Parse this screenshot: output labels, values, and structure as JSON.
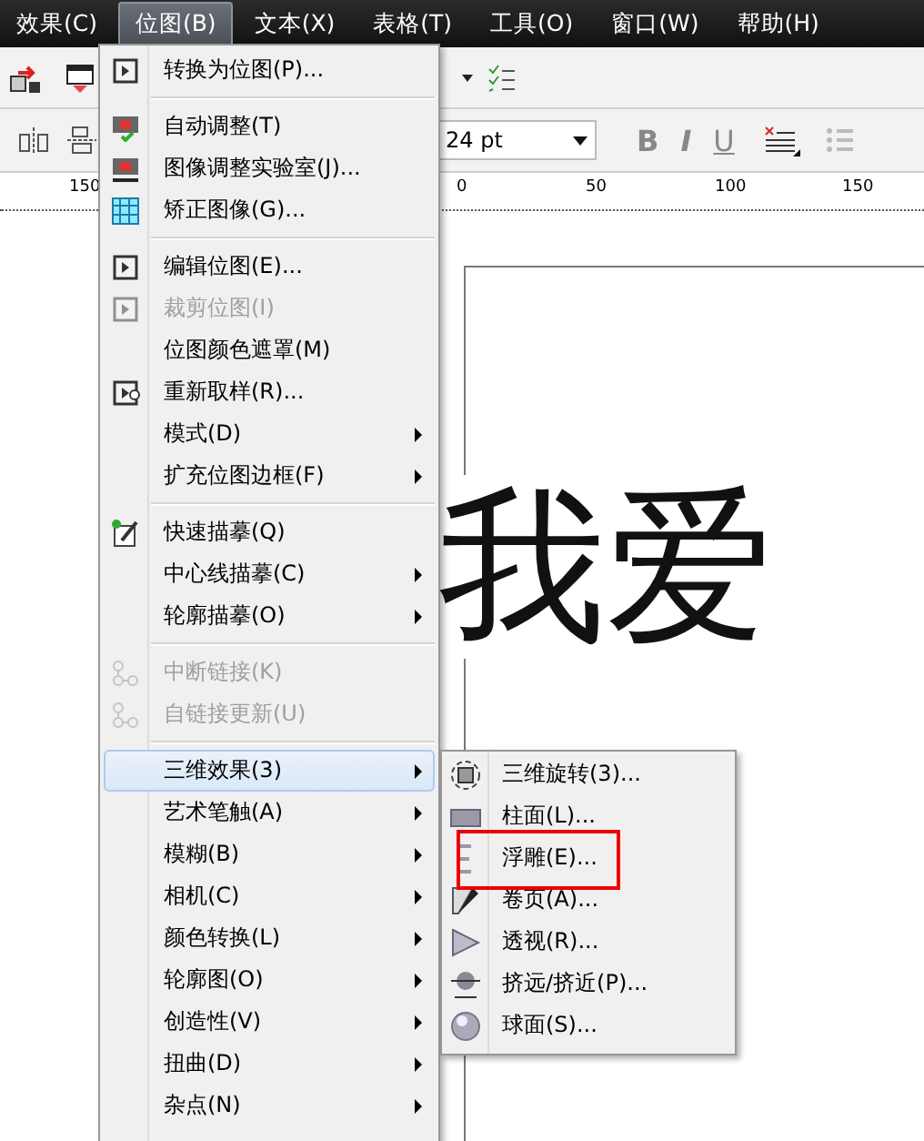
{
  "menubar": [
    {
      "label": "效果(C)",
      "selected": false
    },
    {
      "label": "位图(B)",
      "selected": true
    },
    {
      "label": "文本(X)",
      "selected": false
    },
    {
      "label": "表格(T)",
      "selected": false
    },
    {
      "label": "工具(O)",
      "selected": false
    },
    {
      "label": "窗口(W)",
      "selected": false
    },
    {
      "label": "帮助(H)",
      "selected": false
    }
  ],
  "toolbar": {
    "font_size": "24 pt",
    "format_buttons": [
      "B",
      "I",
      "U"
    ]
  },
  "ruler": {
    "labels": [
      "150",
      "0",
      "50",
      "100",
      "150"
    ]
  },
  "canvas": {
    "text": "我爱"
  },
  "menu": [
    {
      "kind": "item",
      "label": "转换为位图(P)...",
      "disabled": false,
      "submenu": false,
      "selected": false
    },
    {
      "kind": "separator"
    },
    {
      "kind": "item",
      "label": "自动调整(T)",
      "disabled": false,
      "submenu": false,
      "selected": false
    },
    {
      "kind": "item",
      "label": "图像调整实验室(J)...",
      "disabled": false,
      "submenu": false,
      "selected": false
    },
    {
      "kind": "item",
      "label": "矫正图像(G)...",
      "disabled": false,
      "submenu": false,
      "selected": false
    },
    {
      "kind": "separator"
    },
    {
      "kind": "item",
      "label": "编辑位图(E)...",
      "disabled": false,
      "submenu": false,
      "selected": false
    },
    {
      "kind": "item",
      "label": "裁剪位图(I)",
      "disabled": true,
      "submenu": false,
      "selected": false
    },
    {
      "kind": "item",
      "label": "位图颜色遮罩(M)",
      "disabled": false,
      "submenu": false,
      "selected": false
    },
    {
      "kind": "item",
      "label": "重新取样(R)...",
      "disabled": false,
      "submenu": false,
      "selected": false
    },
    {
      "kind": "item",
      "label": "模式(D)",
      "disabled": false,
      "submenu": true,
      "selected": false
    },
    {
      "kind": "item",
      "label": "扩充位图边框(F)",
      "disabled": false,
      "submenu": true,
      "selected": false
    },
    {
      "kind": "separator"
    },
    {
      "kind": "item",
      "label": "快速描摹(Q)",
      "disabled": false,
      "submenu": false,
      "selected": false
    },
    {
      "kind": "item",
      "label": "中心线描摹(C)",
      "disabled": false,
      "submenu": true,
      "selected": false
    },
    {
      "kind": "item",
      "label": "轮廓描摹(O)",
      "disabled": false,
      "submenu": true,
      "selected": false
    },
    {
      "kind": "separator"
    },
    {
      "kind": "item",
      "label": "中断链接(K)",
      "disabled": true,
      "submenu": false,
      "selected": false
    },
    {
      "kind": "item",
      "label": "自链接更新(U)",
      "disabled": true,
      "submenu": false,
      "selected": false
    },
    {
      "kind": "separator"
    },
    {
      "kind": "item",
      "label": "三维效果(3)",
      "disabled": false,
      "submenu": true,
      "selected": true
    },
    {
      "kind": "item",
      "label": "艺术笔触(A)",
      "disabled": false,
      "submenu": true,
      "selected": false
    },
    {
      "kind": "item",
      "label": "模糊(B)",
      "disabled": false,
      "submenu": true,
      "selected": false
    },
    {
      "kind": "item",
      "label": "相机(C)",
      "disabled": false,
      "submenu": true,
      "selected": false
    },
    {
      "kind": "item",
      "label": "颜色转换(L)",
      "disabled": false,
      "submenu": true,
      "selected": false
    },
    {
      "kind": "item",
      "label": "轮廓图(O)",
      "disabled": false,
      "submenu": true,
      "selected": false
    },
    {
      "kind": "item",
      "label": "创造性(V)",
      "disabled": false,
      "submenu": true,
      "selected": false
    },
    {
      "kind": "item",
      "label": "扭曲(D)",
      "disabled": false,
      "submenu": true,
      "selected": false
    },
    {
      "kind": "item",
      "label": "杂点(N)",
      "disabled": false,
      "submenu": true,
      "selected": false
    }
  ],
  "submenu": [
    {
      "label": "三维旋转(3)...",
      "highlighted": false
    },
    {
      "label": "柱面(L)...",
      "highlighted": false
    },
    {
      "label": "浮雕(E)...",
      "highlighted": true
    },
    {
      "label": "卷页(A)...",
      "highlighted": false
    },
    {
      "label": "透视(R)...",
      "highlighted": false
    },
    {
      "label": "挤远/挤近(P)...",
      "highlighted": false
    },
    {
      "label": "球面(S)...",
      "highlighted": false
    }
  ]
}
